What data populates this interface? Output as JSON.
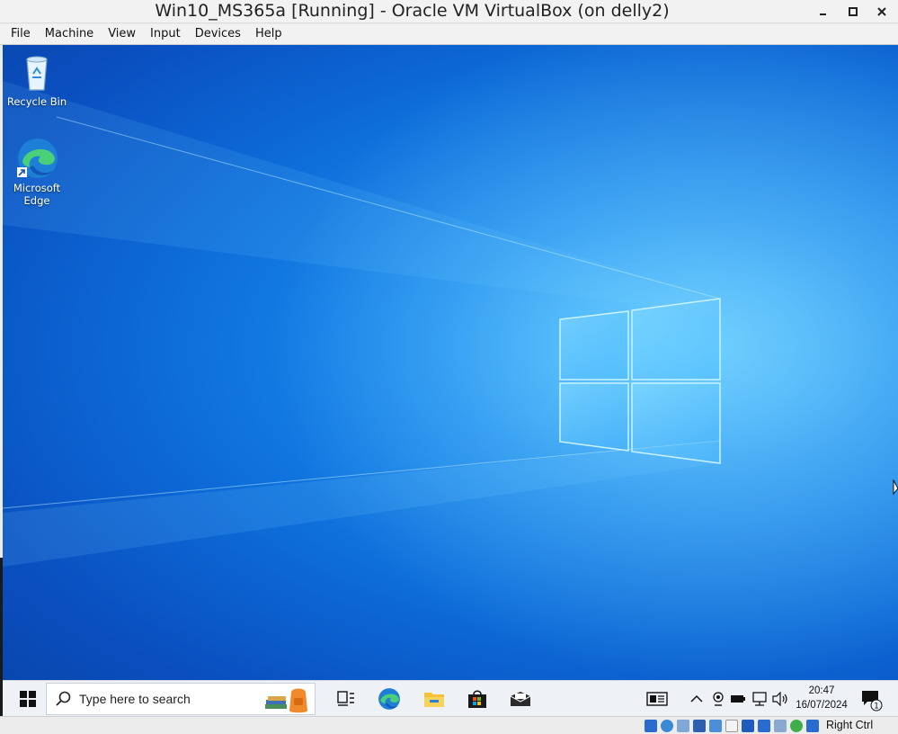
{
  "window": {
    "title": "Win10_MS365a [Running] - Oracle VM VirtualBox (on delly2)",
    "controls": [
      "minimize",
      "maximize",
      "close"
    ]
  },
  "menu": {
    "items": [
      "File",
      "Machine",
      "View",
      "Input",
      "Devices",
      "Help"
    ]
  },
  "desktop": {
    "icons": [
      {
        "label": "Recycle Bin",
        "icon": "recycle-bin-icon"
      },
      {
        "label": "Microsoft Edge",
        "icon": "edge-icon"
      }
    ],
    "wallpaper_colors": {
      "light": "#39b7ff",
      "mid": "#1a8cef",
      "dark": "#0844a8"
    }
  },
  "taskbar": {
    "search_placeholder": "Type here to search",
    "pinned": [
      "task-view-icon",
      "edge-icon",
      "file-explorer-icon",
      "store-icon",
      "mail-icon"
    ],
    "tray": [
      "news-icon",
      "chevron-up-icon",
      "webcam-icon",
      "battery-icon",
      "network-icon",
      "volume-icon"
    ],
    "clock": {
      "time": "20:47",
      "date": "16/07/2024"
    },
    "notification_count": "1"
  },
  "statusbar": {
    "host_key": "Right Ctrl",
    "icons": [
      "hdd-icon",
      "optical-icon",
      "audio-icon",
      "network-icon",
      "usb-icon",
      "shared-folder-icon",
      "display-icon",
      "recording-icon",
      "vrde-icon",
      "cpu-icon",
      "arrow-down-icon"
    ]
  }
}
